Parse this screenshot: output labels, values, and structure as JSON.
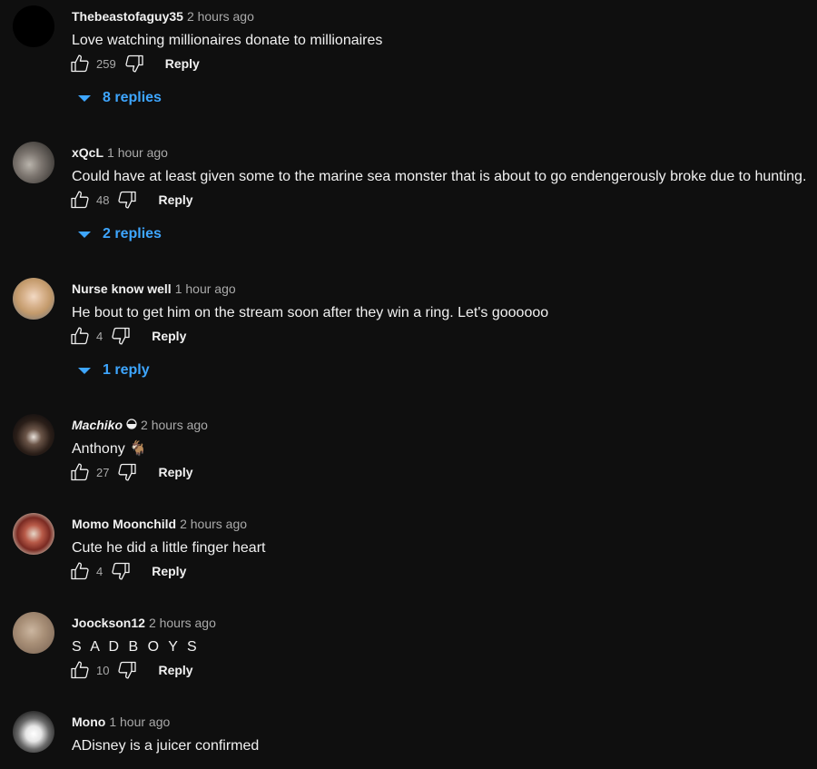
{
  "comments": [
    {
      "author": "Thebeastofaguy35",
      "time": "2 hours ago",
      "text": "Love watching millionaires donate to millionaires",
      "likes": "259",
      "reply_label": "Reply",
      "replies_label": "8 replies"
    },
    {
      "author": "xQcL",
      "time": "1 hour ago",
      "text": "Could have at least given some to the marine sea monster that is about to go endengerously broke due to hunting.",
      "likes": "48",
      "reply_label": "Reply",
      "replies_label": "2 replies"
    },
    {
      "author": "Nurse know well",
      "time": "1 hour ago",
      "text": "He bout to get him on the stream soon after they win a ring. Let's goooooo",
      "likes": "4",
      "reply_label": "Reply",
      "replies_label": "1 reply"
    },
    {
      "author": "Machiko",
      "time": "2 hours ago",
      "text": "Anthony 🐐",
      "likes": "27",
      "reply_label": "Reply"
    },
    {
      "author": "Momo Moonchild",
      "time": "2 hours ago",
      "text": "Cute he did a little finger heart",
      "likes": "4",
      "reply_label": "Reply"
    },
    {
      "author": "Joockson12",
      "time": "2 hours ago",
      "text": "S A D B O Y S",
      "likes": "10",
      "reply_label": "Reply"
    },
    {
      "author": "Mono",
      "time": "1 hour ago",
      "text": "ADisney is a juicer confirmed"
    }
  ],
  "icons": {
    "like": "thumbs-up-outline",
    "dislike": "thumbs-down-outline",
    "expand": "caret-down",
    "member_badge": "half-circle-badge"
  },
  "colors": {
    "background": "#0f0f0f",
    "primary_text": "#f1f1f1",
    "secondary_text": "#aaaaaa",
    "link_blue": "#3ea6ff"
  }
}
